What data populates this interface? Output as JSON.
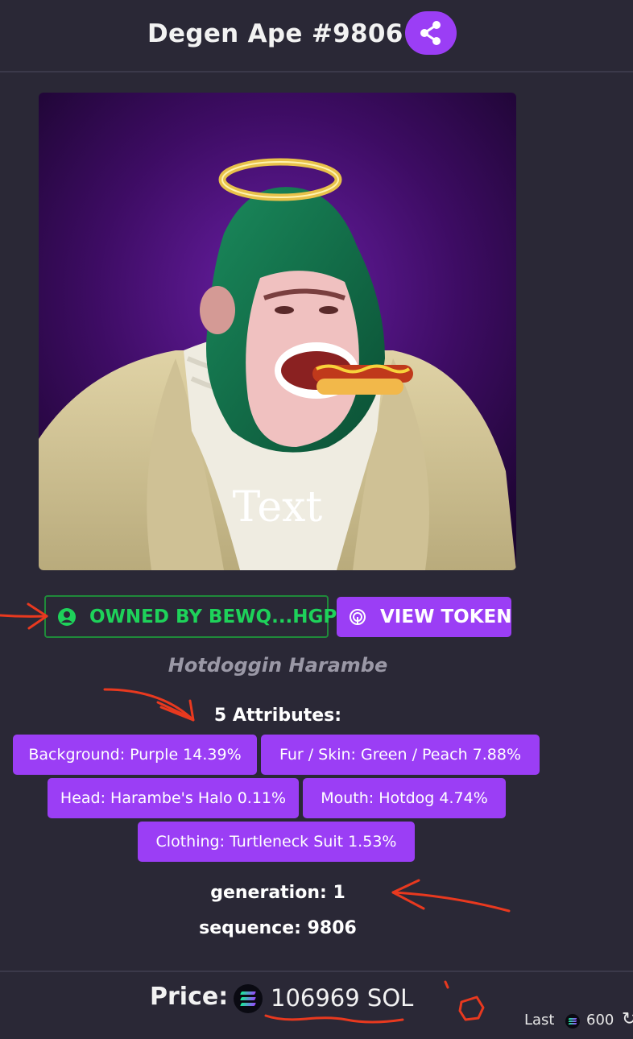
{
  "header": {
    "title": "Degen Ape #9806",
    "share_icon": "share-icon",
    "accent_color": "#9b3ef5"
  },
  "artwork": {
    "overlay_text": "Text"
  },
  "actions": {
    "owned_label": "OWNED BY BEWQ...HGPF",
    "owned_icon": "user-icon",
    "owned_color": "#1ed25a",
    "view_token_label": "VIEW TOKEN",
    "view_token_icon": "fingerprint-icon"
  },
  "nft": {
    "name": "Hotdoggin Harambe",
    "attributes_heading": "5 Attributes:",
    "attributes": [
      "Background: Purple 14.39%",
      "Fur / Skin: Green / Peach 7.88%",
      "Head: Harambe's Halo 0.11%",
      "Mouth: Hotdog 4.74%",
      "Clothing: Turtleneck Suit 1.53%"
    ],
    "generation": "generation: 1",
    "sequence": "sequence: 9806"
  },
  "footer": {
    "price_label": "Price:",
    "price_value": "106969 SOL",
    "currency_icon": "solana-icon",
    "last_label": "Last",
    "last_value": "600",
    "last_icon": "refresh-icon"
  },
  "annotation_color": "#e8391f"
}
